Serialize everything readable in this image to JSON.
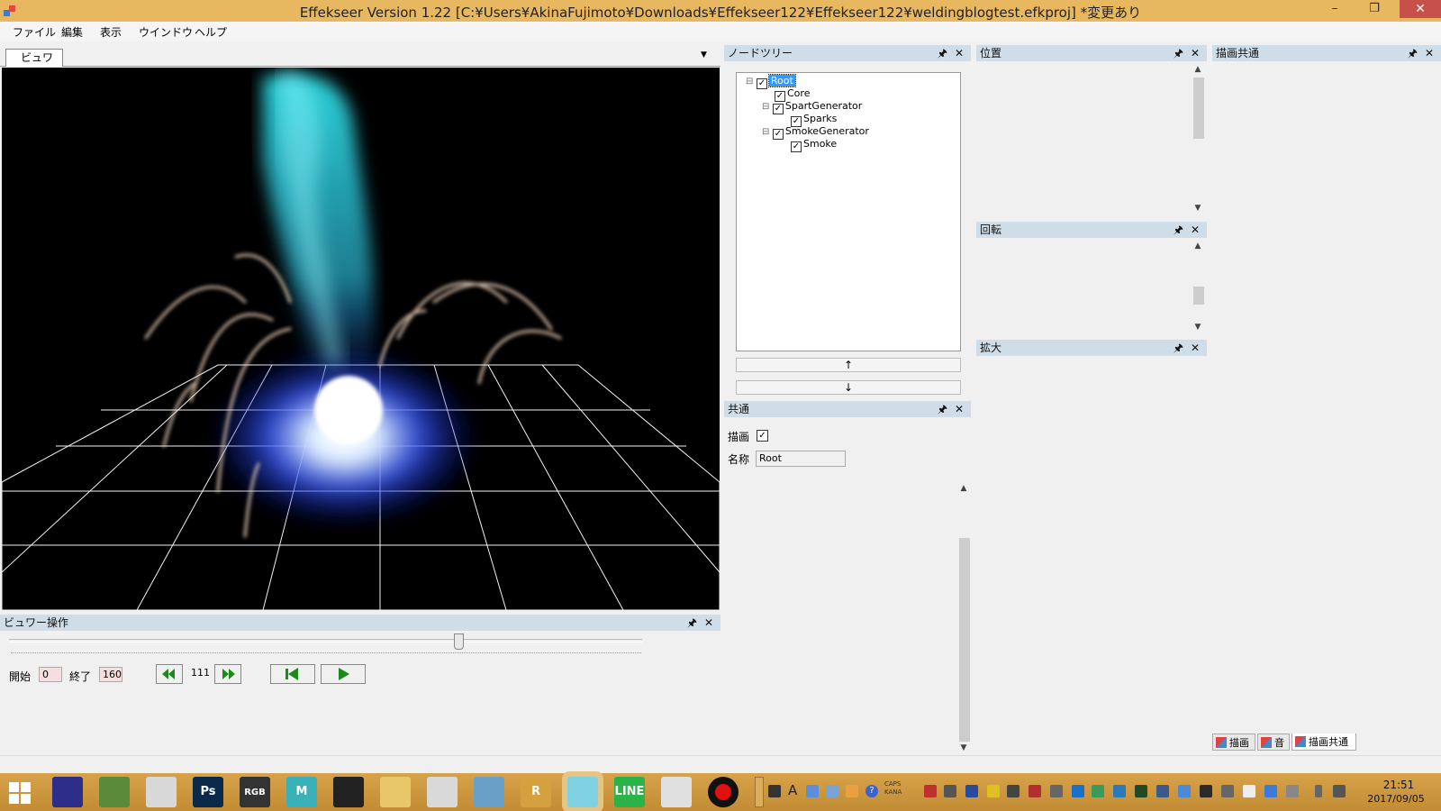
{
  "window": {
    "title": "Effekseer Version 1.22 [C:¥Users¥AkinaFujimoto¥Downloads¥Effekseer122¥Effekseer122¥weldingblogtest.efkproj]  *変更あり",
    "minimize": "–",
    "maximize": "❐",
    "close": "✕"
  },
  "menu": [
    "ファイル",
    "編集",
    "表示",
    "ウインドウ",
    "ヘルプ"
  ],
  "viewer": {
    "tab_label": "ビュワー",
    "dropdown": "▼"
  },
  "node_tree": {
    "title": "ノードツリー",
    "nodes": [
      {
        "label": "Root",
        "checked": true,
        "expander": "⊟",
        "selected": true
      },
      {
        "label": "Core",
        "checked": true,
        "expander": ""
      },
      {
        "label": "SpartGenerator",
        "checked": true,
        "expander": "⊟"
      },
      {
        "label": "Sparks",
        "checked": true,
        "expander": ""
      },
      {
        "label": "SmokeGenerator",
        "checked": true,
        "expander": "⊟"
      },
      {
        "label": "Smoke",
        "checked": true,
        "expander": ""
      }
    ],
    "up_button": "↑",
    "down_button": "↓"
  },
  "common": {
    "title": "共通",
    "draw_label": "描画",
    "draw_checked": true,
    "name_label": "名称",
    "name_value": "Root"
  },
  "position_panel": {
    "title": "位置"
  },
  "rotation_panel": {
    "title": "回転"
  },
  "scale_panel": {
    "title": "拡大"
  },
  "render_common_panel": {
    "title": "描画共通"
  },
  "viewer_control": {
    "title": "ビュワー操作",
    "start_label": "開始",
    "start_value": "0",
    "end_label": "終了",
    "end_value": "160",
    "current_frame": "111",
    "slider_fraction": 0.71
  },
  "panel_buttons": {
    "pin": "🖈",
    "close": "✕"
  },
  "bottom_tabs": [
    "描画",
    "音",
    "描画共通"
  ],
  "taskbar": {
    "time": "21:51",
    "date": "2017/09/05",
    "caps_label": "CAPS",
    "kana_label": "KANA",
    "apps": [
      {
        "icon": "visual-studio-icon",
        "label": "",
        "color": "#2d2d8a"
      },
      {
        "icon": "hexagon-app-icon",
        "label": "",
        "color": "#5a8a3a"
      },
      {
        "icon": "color-wheel-icon",
        "label": "",
        "color": "#d8d8d8"
      },
      {
        "icon": "photoshop-icon",
        "label": "Ps",
        "color": "#0b2a4a"
      },
      {
        "icon": "rgb-checker-icon",
        "label": "RGB",
        "color": "#333333"
      },
      {
        "icon": "maya-icon",
        "label": "M",
        "color": "#3ab0b8"
      },
      {
        "icon": "film-icon",
        "label": "",
        "color": "#222222"
      },
      {
        "icon": "folder-icon",
        "label": "",
        "color": "#e8c66a"
      },
      {
        "icon": "chrome-icon",
        "label": "",
        "color": "#d9d9d9"
      },
      {
        "icon": "notebook-icon",
        "label": "",
        "color": "#6aa0c8"
      },
      {
        "icon": "r-app-icon",
        "label": "R",
        "color": "#d4a040"
      },
      {
        "icon": "effekseer-icon",
        "label": "",
        "color": "#7fd0e0"
      },
      {
        "icon": "line-icon",
        "label": "LINE",
        "color": "#2bb34a"
      },
      {
        "icon": "window-app-icon",
        "label": "",
        "color": "#e0e0e0"
      },
      {
        "icon": "record-icon",
        "label": "",
        "color": "#111111"
      }
    ],
    "colors": {
      "bar": "#c99338",
      "active": "#e6c483"
    }
  }
}
